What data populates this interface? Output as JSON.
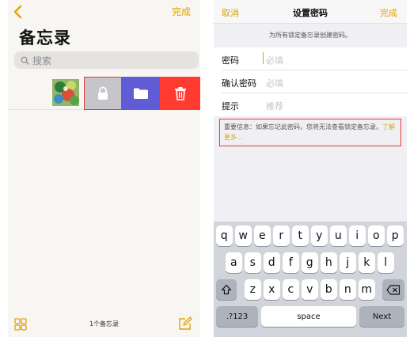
{
  "left": {
    "done": "完成",
    "title": "备忘录",
    "search_placeholder": "搜索",
    "count": "1个备忘录"
  },
  "right": {
    "cancel": "取消",
    "title": "设置密码",
    "done": "完成",
    "hint": "为所有锁定备忘录创建密码。",
    "fields": [
      {
        "label": "密码",
        "placeholder": "必填"
      },
      {
        "label": "确认密码",
        "placeholder": "必填"
      },
      {
        "label": "提示",
        "placeholder": "推荐"
      }
    ],
    "warning": "重要信息：如果忘记此密码，您将无法查看锁定备忘录。",
    "learn_more": "了解更多...",
    "keyboard": {
      "row1": [
        "q",
        "w",
        "e",
        "r",
        "t",
        "y",
        "u",
        "i",
        "o",
        "p"
      ],
      "row2": [
        "a",
        "s",
        "d",
        "f",
        "g",
        "h",
        "j",
        "k",
        "l"
      ],
      "row3": [
        "z",
        "x",
        "c",
        "v",
        "b",
        "n",
        "m"
      ],
      "numbers": ".?123",
      "space": "space",
      "next": "Next"
    }
  },
  "colors": {
    "accent": "#e0a400",
    "lock_action": "#c6c6ca",
    "folder_action": "#5f5cd6",
    "delete_action": "#ff3b30",
    "highlight_border": "#e53935"
  },
  "icons": [
    "chevron-left-icon",
    "search-icon",
    "lock-icon",
    "folder-icon",
    "trash-icon",
    "grid-icon",
    "compose-icon",
    "shift-icon",
    "backspace-icon"
  ]
}
